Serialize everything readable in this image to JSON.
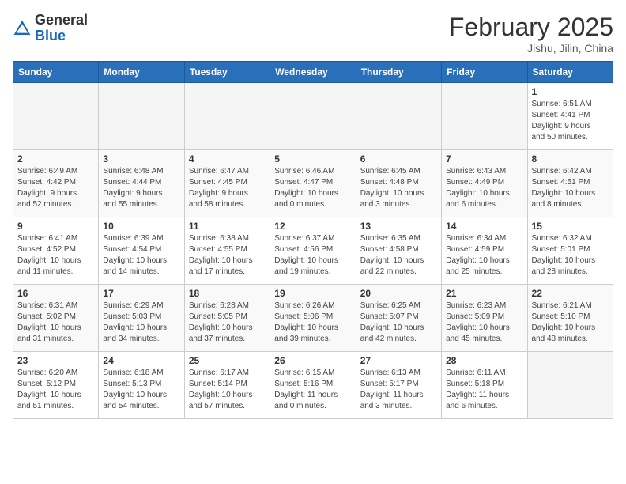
{
  "header": {
    "logo_general": "General",
    "logo_blue": "Blue",
    "month_title": "February 2025",
    "location": "Jishu, Jilin, China"
  },
  "weekdays": [
    "Sunday",
    "Monday",
    "Tuesday",
    "Wednesday",
    "Thursday",
    "Friday",
    "Saturday"
  ],
  "weeks": [
    [
      {
        "day": "",
        "info": ""
      },
      {
        "day": "",
        "info": ""
      },
      {
        "day": "",
        "info": ""
      },
      {
        "day": "",
        "info": ""
      },
      {
        "day": "",
        "info": ""
      },
      {
        "day": "",
        "info": ""
      },
      {
        "day": "1",
        "info": "Sunrise: 6:51 AM\nSunset: 4:41 PM\nDaylight: 9 hours\nand 50 minutes."
      }
    ],
    [
      {
        "day": "2",
        "info": "Sunrise: 6:49 AM\nSunset: 4:42 PM\nDaylight: 9 hours\nand 52 minutes."
      },
      {
        "day": "3",
        "info": "Sunrise: 6:48 AM\nSunset: 4:44 PM\nDaylight: 9 hours\nand 55 minutes."
      },
      {
        "day": "4",
        "info": "Sunrise: 6:47 AM\nSunset: 4:45 PM\nDaylight: 9 hours\nand 58 minutes."
      },
      {
        "day": "5",
        "info": "Sunrise: 6:46 AM\nSunset: 4:47 PM\nDaylight: 10 hours\nand 0 minutes."
      },
      {
        "day": "6",
        "info": "Sunrise: 6:45 AM\nSunset: 4:48 PM\nDaylight: 10 hours\nand 3 minutes."
      },
      {
        "day": "7",
        "info": "Sunrise: 6:43 AM\nSunset: 4:49 PM\nDaylight: 10 hours\nand 6 minutes."
      },
      {
        "day": "8",
        "info": "Sunrise: 6:42 AM\nSunset: 4:51 PM\nDaylight: 10 hours\nand 8 minutes."
      }
    ],
    [
      {
        "day": "9",
        "info": "Sunrise: 6:41 AM\nSunset: 4:52 PM\nDaylight: 10 hours\nand 11 minutes."
      },
      {
        "day": "10",
        "info": "Sunrise: 6:39 AM\nSunset: 4:54 PM\nDaylight: 10 hours\nand 14 minutes."
      },
      {
        "day": "11",
        "info": "Sunrise: 6:38 AM\nSunset: 4:55 PM\nDaylight: 10 hours\nand 17 minutes."
      },
      {
        "day": "12",
        "info": "Sunrise: 6:37 AM\nSunset: 4:56 PM\nDaylight: 10 hours\nand 19 minutes."
      },
      {
        "day": "13",
        "info": "Sunrise: 6:35 AM\nSunset: 4:58 PM\nDaylight: 10 hours\nand 22 minutes."
      },
      {
        "day": "14",
        "info": "Sunrise: 6:34 AM\nSunset: 4:59 PM\nDaylight: 10 hours\nand 25 minutes."
      },
      {
        "day": "15",
        "info": "Sunrise: 6:32 AM\nSunset: 5:01 PM\nDaylight: 10 hours\nand 28 minutes."
      }
    ],
    [
      {
        "day": "16",
        "info": "Sunrise: 6:31 AM\nSunset: 5:02 PM\nDaylight: 10 hours\nand 31 minutes."
      },
      {
        "day": "17",
        "info": "Sunrise: 6:29 AM\nSunset: 5:03 PM\nDaylight: 10 hours\nand 34 minutes."
      },
      {
        "day": "18",
        "info": "Sunrise: 6:28 AM\nSunset: 5:05 PM\nDaylight: 10 hours\nand 37 minutes."
      },
      {
        "day": "19",
        "info": "Sunrise: 6:26 AM\nSunset: 5:06 PM\nDaylight: 10 hours\nand 39 minutes."
      },
      {
        "day": "20",
        "info": "Sunrise: 6:25 AM\nSunset: 5:07 PM\nDaylight: 10 hours\nand 42 minutes."
      },
      {
        "day": "21",
        "info": "Sunrise: 6:23 AM\nSunset: 5:09 PM\nDaylight: 10 hours\nand 45 minutes."
      },
      {
        "day": "22",
        "info": "Sunrise: 6:21 AM\nSunset: 5:10 PM\nDaylight: 10 hours\nand 48 minutes."
      }
    ],
    [
      {
        "day": "23",
        "info": "Sunrise: 6:20 AM\nSunset: 5:12 PM\nDaylight: 10 hours\nand 51 minutes."
      },
      {
        "day": "24",
        "info": "Sunrise: 6:18 AM\nSunset: 5:13 PM\nDaylight: 10 hours\nand 54 minutes."
      },
      {
        "day": "25",
        "info": "Sunrise: 6:17 AM\nSunset: 5:14 PM\nDaylight: 10 hours\nand 57 minutes."
      },
      {
        "day": "26",
        "info": "Sunrise: 6:15 AM\nSunset: 5:16 PM\nDaylight: 11 hours\nand 0 minutes."
      },
      {
        "day": "27",
        "info": "Sunrise: 6:13 AM\nSunset: 5:17 PM\nDaylight: 11 hours\nand 3 minutes."
      },
      {
        "day": "28",
        "info": "Sunrise: 6:11 AM\nSunset: 5:18 PM\nDaylight: 11 hours\nand 6 minutes."
      },
      {
        "day": "",
        "info": ""
      }
    ]
  ]
}
